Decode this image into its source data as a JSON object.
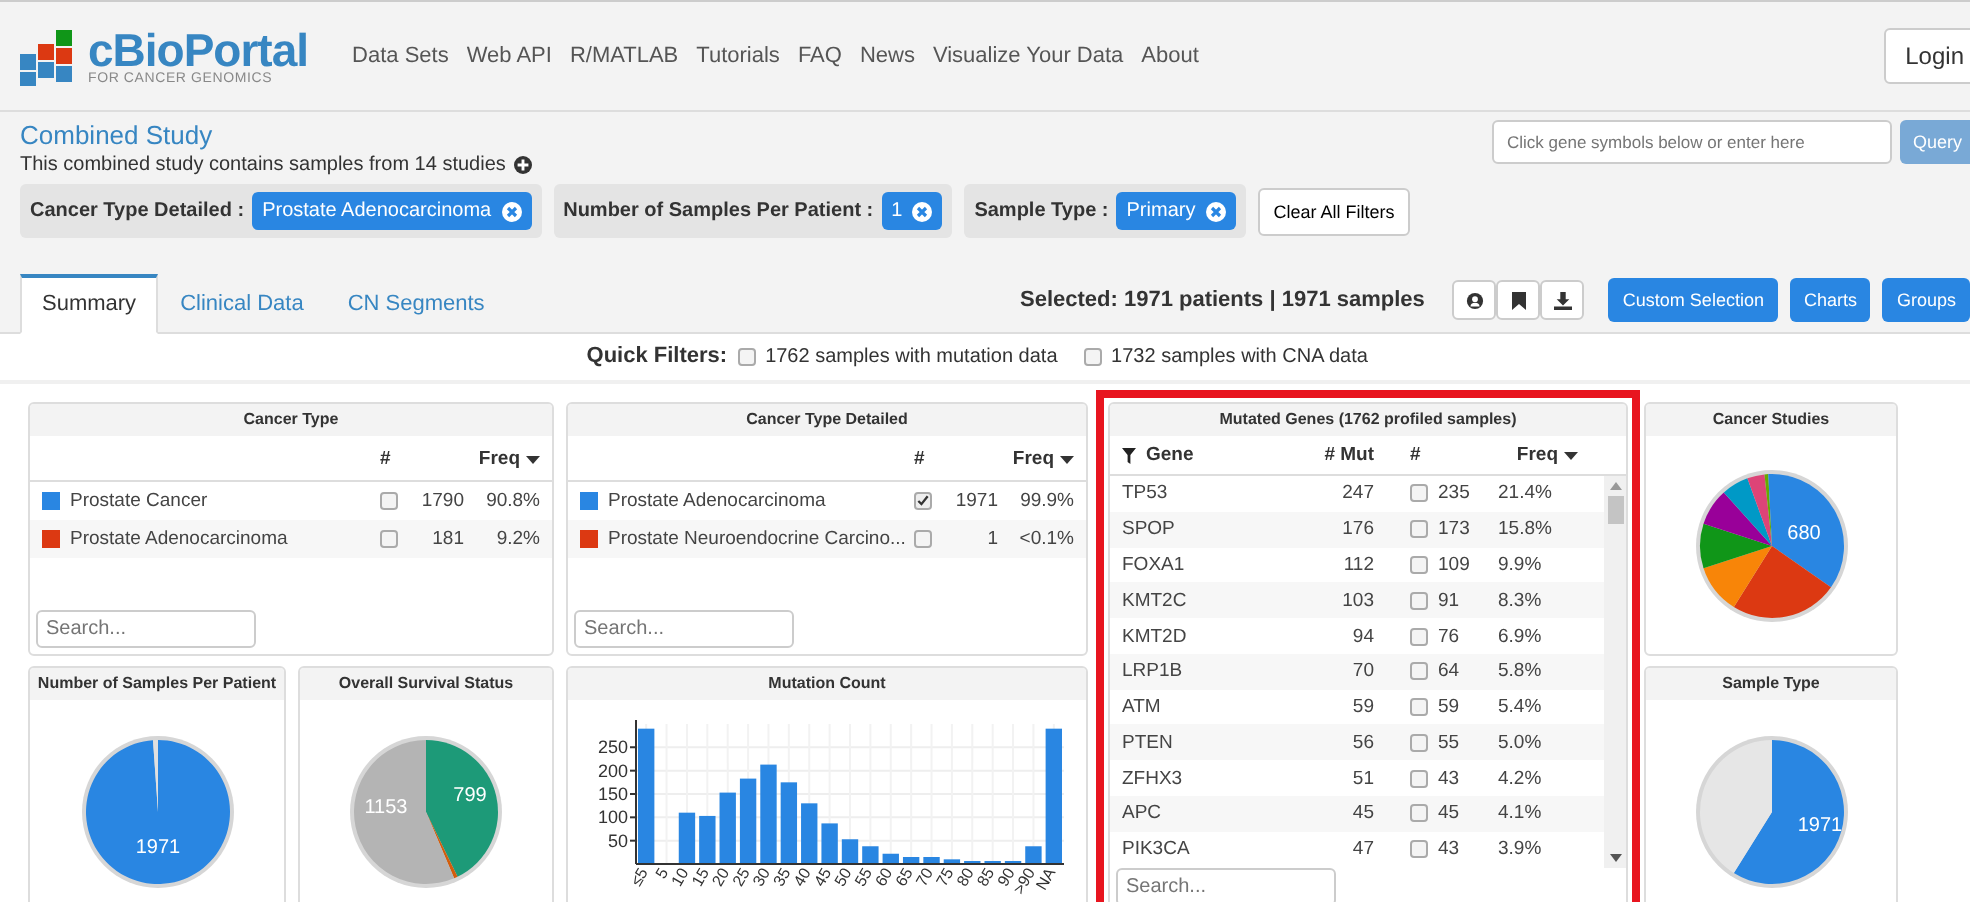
{
  "header": {
    "logo_title": "cBioPortal",
    "logo_subtitle": "FOR CANCER GENOMICS",
    "nav": [
      "Data Sets",
      "Web API",
      "R/MATLAB",
      "Tutorials",
      "FAQ",
      "News",
      "Visualize Your Data",
      "About"
    ],
    "login": "Login"
  },
  "study": {
    "title": "Combined Study",
    "description": "This combined study contains samples from 14 studies",
    "filters": [
      {
        "label": "Cancer Type Detailed :",
        "value": "Prostate Adenocarcinoma"
      },
      {
        "label": "Number of Samples Per Patient :",
        "value": "1"
      },
      {
        "label": "Sample Type :",
        "value": "Primary"
      }
    ],
    "clear_button": "Clear All Filters"
  },
  "gene_query": {
    "placeholder": "Click gene symbols below or enter here",
    "button": "Query"
  },
  "tabs": [
    {
      "label": "Summary",
      "selected": true
    },
    {
      "label": "Clinical Data",
      "selected": false
    },
    {
      "label": "CN Segments",
      "selected": false
    }
  ],
  "selection_summary": "Selected: 1971 patients | 1971 samples",
  "action_buttons": [
    "Custom Selection",
    "Charts",
    "Groups"
  ],
  "quick_filters": {
    "label": "Quick Filters:",
    "options": [
      {
        "label": "1762 samples with mutation data",
        "checked": false
      },
      {
        "label": "1732 samples with CNA data",
        "checked": false
      }
    ]
  },
  "cancer_type": {
    "title": "Cancer Type",
    "columns": [
      "#",
      "Freq"
    ],
    "rows": [
      {
        "color": "#2986e2",
        "name": "Prostate Cancer",
        "checked": false,
        "count": "1790",
        "freq": "90.8%"
      },
      {
        "color": "#dc3912",
        "name": "Prostate Adenocarcinoma",
        "checked": false,
        "count": "181",
        "freq": "9.2%"
      }
    ],
    "search_placeholder": "Search..."
  },
  "cancer_type_detailed": {
    "title": "Cancer Type Detailed",
    "columns": [
      "#",
      "Freq"
    ],
    "rows": [
      {
        "color": "#2986e2",
        "name": "Prostate Adenocarcinoma",
        "checked": true,
        "count": "1971",
        "freq": "99.9%"
      },
      {
        "color": "#dc3912",
        "name": "Prostate Neuroendocrine Carcino...",
        "checked": false,
        "count": "1",
        "freq": "<0.1%"
      }
    ],
    "search_placeholder": "Search..."
  },
  "mutated_genes": {
    "title": "Mutated Genes (1762 profiled samples)",
    "highlighted": true,
    "columns": [
      "Gene",
      "# Mut",
      "#",
      "Freq"
    ],
    "rows": [
      {
        "gene": "TP53",
        "mut": "247",
        "checked": false,
        "count": "235",
        "freq": "21.4%"
      },
      {
        "gene": "SPOP",
        "mut": "176",
        "checked": false,
        "count": "173",
        "freq": "15.8%"
      },
      {
        "gene": "FOXA1",
        "mut": "112",
        "checked": false,
        "count": "109",
        "freq": "9.9%"
      },
      {
        "gene": "KMT2C",
        "mut": "103",
        "checked": false,
        "count": "91",
        "freq": "8.3%"
      },
      {
        "gene": "KMT2D",
        "mut": "94",
        "checked": false,
        "count": "76",
        "freq": "6.9%"
      },
      {
        "gene": "LRP1B",
        "mut": "70",
        "checked": false,
        "count": "64",
        "freq": "5.8%"
      },
      {
        "gene": "ATM",
        "mut": "59",
        "checked": false,
        "count": "59",
        "freq": "5.4%"
      },
      {
        "gene": "PTEN",
        "mut": "56",
        "checked": false,
        "count": "55",
        "freq": "5.0%"
      },
      {
        "gene": "ZFHX3",
        "mut": "51",
        "checked": false,
        "count": "43",
        "freq": "4.2%"
      },
      {
        "gene": "APC",
        "mut": "45",
        "checked": false,
        "count": "45",
        "freq": "4.1%"
      },
      {
        "gene": "PIK3CA",
        "mut": "47",
        "checked": false,
        "count": "43",
        "freq": "3.9%"
      }
    ],
    "search_placeholder": "Search..."
  },
  "cancer_studies": {
    "title": "Cancer Studies",
    "label": "680"
  },
  "samples_per_patient": {
    "title": "Number of Samples Per Patient",
    "label": "1971"
  },
  "survival": {
    "title": "Overall Survival Status",
    "labels": [
      "1153",
      "799"
    ]
  },
  "mutation_count": {
    "title": "Mutation Count",
    "chart_data": {
      "type": "bar",
      "categories": [
        "≤5",
        "5",
        "10",
        "15",
        "20",
        "25",
        "30",
        "35",
        "40",
        "45",
        "50",
        "55",
        "60",
        "65",
        "70",
        "75",
        "80",
        "85",
        "90",
        ">90",
        "NA"
      ],
      "grid": true,
      "series": [
        {
          "color": "#2986e2",
          "values": [
            290,
            null,
            110,
            103,
            153,
            183,
            213,
            175,
            130,
            87,
            53,
            38,
            22,
            15,
            15,
            10,
            2,
            2,
            6,
            38,
            290
          ]
        }
      ],
      "ylim": [
        0,
        300
      ],
      "yticks": [
        50,
        100,
        150,
        200,
        250
      ]
    }
  },
  "sample_type": {
    "title": "Sample Type",
    "label": "1971"
  }
}
